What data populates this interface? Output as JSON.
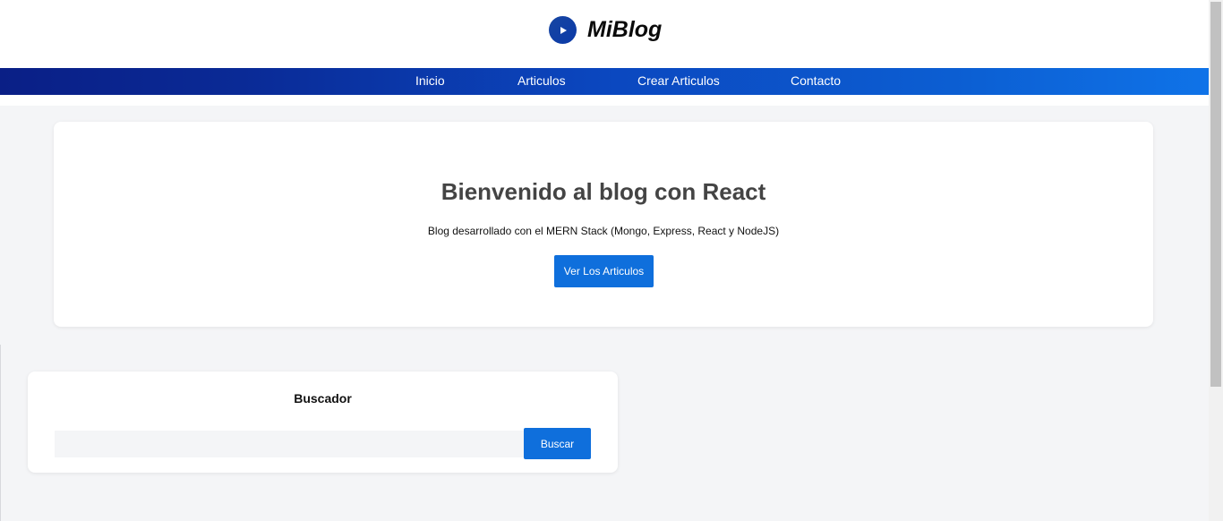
{
  "header": {
    "brand_title": "MiBlog",
    "logo_icon": "play-icon"
  },
  "nav": {
    "items": [
      {
        "label": "Inicio"
      },
      {
        "label": "Articulos"
      },
      {
        "label": "Crear Articulos"
      },
      {
        "label": "Contacto"
      }
    ]
  },
  "hero": {
    "title": "Bienvenido al blog con React",
    "subtitle": "Blog desarrollado con el MERN Stack (Mongo, Express, React y NodeJS)",
    "button_label": "Ver Los Articulos"
  },
  "search": {
    "title": "Buscador",
    "input_value": "",
    "input_placeholder": "",
    "button_label": "Buscar"
  },
  "colors": {
    "accent": "#0f6fdc",
    "nav_gradient_start": "#0a1f86",
    "nav_gradient_end": "#0f73e8",
    "page_background": "#f4f5f7"
  }
}
